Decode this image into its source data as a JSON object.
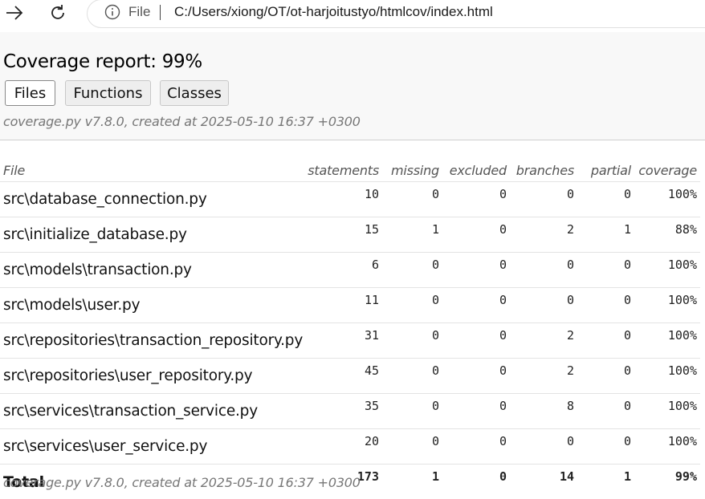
{
  "browser": {
    "file_label": "File",
    "url": "C:/Users/xiong/OT/ot-harjoitustyo/htmlcov/index.html"
  },
  "header": {
    "title": "Coverage report: 99%",
    "tabs": [
      {
        "label": "Files",
        "active": true
      },
      {
        "label": "Functions",
        "active": false
      },
      {
        "label": "Classes",
        "active": false
      }
    ],
    "created": "coverage.py v7.8.0, created at 2025-05-10 16:37 +0300"
  },
  "table": {
    "columns": [
      "File",
      "statements",
      "missing",
      "excluded",
      "branches",
      "partial",
      "coverage"
    ],
    "rows": [
      {
        "file": "src\\database_connection.py",
        "statements": "10",
        "missing": "0",
        "excluded": "0",
        "branches": "0",
        "partial": "0",
        "coverage": "100%"
      },
      {
        "file": "src\\initialize_database.py",
        "statements": "15",
        "missing": "1",
        "excluded": "0",
        "branches": "2",
        "partial": "1",
        "coverage": "88%"
      },
      {
        "file": "src\\models\\transaction.py",
        "statements": "6",
        "missing": "0",
        "excluded": "0",
        "branches": "0",
        "partial": "0",
        "coverage": "100%"
      },
      {
        "file": "src\\models\\user.py",
        "statements": "11",
        "missing": "0",
        "excluded": "0",
        "branches": "0",
        "partial": "0",
        "coverage": "100%"
      },
      {
        "file": "src\\repositories\\transaction_repository.py",
        "statements": "31",
        "missing": "0",
        "excluded": "0",
        "branches": "2",
        "partial": "0",
        "coverage": "100%"
      },
      {
        "file": "src\\repositories\\user_repository.py",
        "statements": "45",
        "missing": "0",
        "excluded": "0",
        "branches": "2",
        "partial": "0",
        "coverage": "100%"
      },
      {
        "file": "src\\services\\transaction_service.py",
        "statements": "35",
        "missing": "0",
        "excluded": "0",
        "branches": "8",
        "partial": "0",
        "coverage": "100%"
      },
      {
        "file": "src\\services\\user_service.py",
        "statements": "20",
        "missing": "0",
        "excluded": "0",
        "branches": "0",
        "partial": "0",
        "coverage": "100%"
      }
    ],
    "total": {
      "file": "Total",
      "statements": "173",
      "missing": "1",
      "excluded": "0",
      "branches": "14",
      "partial": "1",
      "coverage": "99%"
    }
  },
  "footer": {
    "created": "coverage.py v7.8.0, created at 2025-05-10 16:37 +0300"
  }
}
